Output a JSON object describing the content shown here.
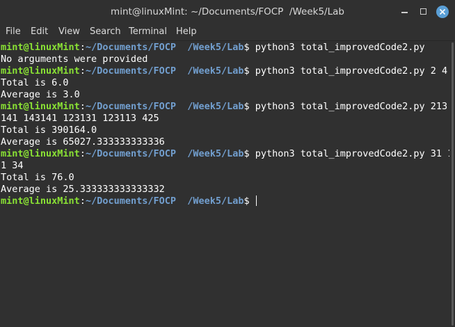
{
  "window": {
    "title": "mint@linuxMint: ~/Documents/FOCP  /Week5/Lab"
  },
  "menu": {
    "items": [
      "File",
      "Edit",
      "View",
      "Search",
      "Terminal",
      "Help"
    ]
  },
  "colors": {
    "user_host": "#8ae234",
    "path": "#729fcf",
    "text": "#ffffff",
    "background": "#303030",
    "close_button": "#5a9fd6"
  },
  "terminal": {
    "prompt_user": "mint@linuxMint",
    "prompt_sep": ":",
    "prompt_path": "~/Documents/FOCP  /Week5/Lab",
    "prompt_dollar": "$ ",
    "commands": [
      "python3 total_improvedCode2.py",
      "python3 total_improvedCode2.py 2 4",
      "python3 total_improvedCode2.py 213",
      "python3 total_improvedCode2.py 31 1"
    ],
    "outputs": [
      "No arguments were provided",
      "Total is 6.0",
      "Average is 3.0",
      "141 143141 123131 123113 425",
      "Total is 390164.0",
      "Average is 65027.333333333336",
      "1 34",
      "Total is 76.0",
      "Average is 25.333333333333332"
    ]
  }
}
